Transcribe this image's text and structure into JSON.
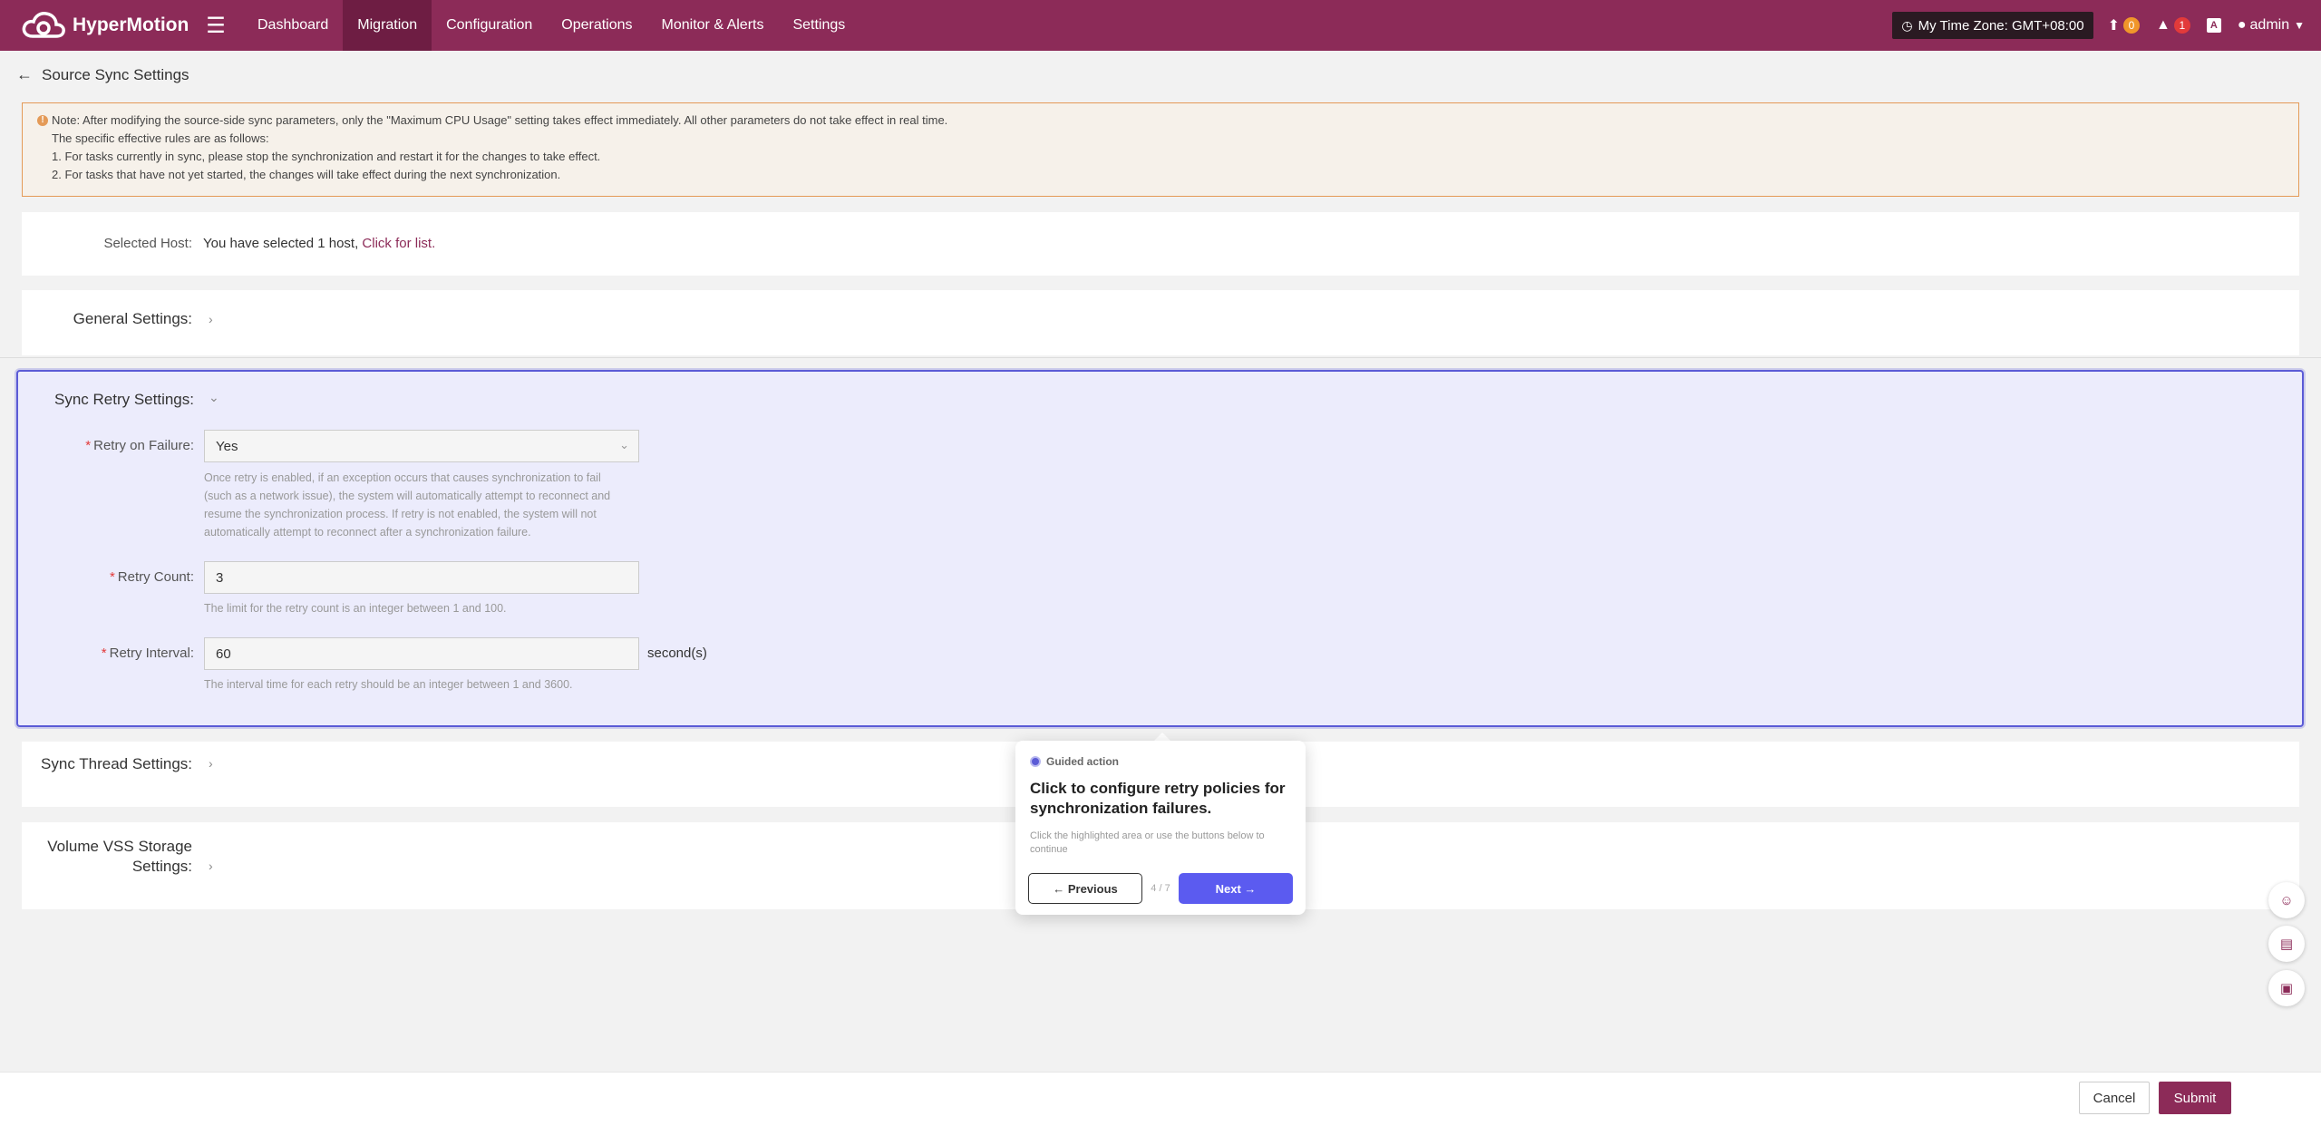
{
  "app": {
    "name": "HyperMotion"
  },
  "nav": {
    "items": [
      {
        "label": "Dashboard"
      },
      {
        "label": "Migration"
      },
      {
        "label": "Configuration"
      },
      {
        "label": "Operations"
      },
      {
        "label": "Monitor & Alerts"
      },
      {
        "label": "Settings"
      }
    ],
    "active": "Migration"
  },
  "topbar": {
    "timezone": "My Time Zone: GMT+08:00",
    "upload_count": "0",
    "alert_count": "1",
    "user": "admin"
  },
  "page": {
    "title": "Source Sync Settings"
  },
  "note": {
    "lines": [
      "Note: After modifying the source-side sync parameters, only the \"Maximum CPU Usage\" setting takes effect immediately. All other parameters do not take effect in real time.",
      "The specific effective rules are as follows:",
      "1. For tasks currently in sync, please stop the synchronization and restart it for the changes to take effect.",
      "2. For tasks that have not yet started, the changes will take effect during the next synchronization."
    ]
  },
  "host": {
    "label": "Selected Host:",
    "text": "You have selected 1 host,",
    "link": "Click for list."
  },
  "sections": {
    "general": "General Settings:",
    "sync_retry": "Sync Retry Settings:",
    "sync_thread": "Sync Thread Settings:",
    "vss_line1": "Volume VSS Storage",
    "vss_line2": "Settings:"
  },
  "retry": {
    "on_failure": {
      "label": "Retry on Failure:",
      "value": "Yes",
      "help": [
        "Once retry is enabled, if an exception occurs that causes synchronization to fail",
        "(such as a network issue), the system will automatically attempt to reconnect and",
        "resume the synchronization process. If retry is not enabled, the system will not",
        "automatically attempt to reconnect after a synchronization failure."
      ]
    },
    "count": {
      "label": "Retry Count:",
      "value": "3",
      "help": "The limit for the retry count is an integer between 1 and 100."
    },
    "interval": {
      "label": "Retry Interval:",
      "value": "60",
      "unit": "second(s)",
      "help": "The interval time for each retry should be an integer between 1 and 3600."
    }
  },
  "guide": {
    "kicker": "Guided action",
    "title": "Click to configure retry policies for synchronization failures.",
    "body": "Click the highlighted area or use the buttons below to continue",
    "prev": "← Previous",
    "step": "4 / 7",
    "next": "Next →"
  },
  "footer": {
    "cancel": "Cancel",
    "submit": "Submit"
  },
  "colors": {
    "brand": "#8c2b58",
    "highlight": "#5b5bd6",
    "warning": "#e49a57"
  }
}
